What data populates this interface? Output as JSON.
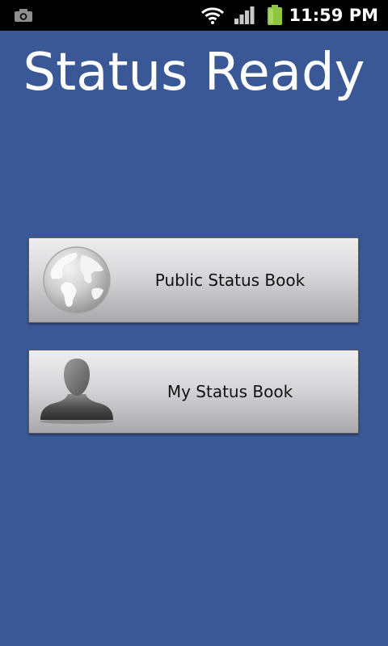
{
  "status_bar": {
    "time": "11:59 PM",
    "icons": [
      "camera-icon",
      "wifi-icon",
      "signal-icon",
      "battery-icon"
    ],
    "battery_color": "#8ec63f"
  },
  "title": "Status Ready",
  "buttons": [
    {
      "label": "Public Status Book",
      "icon": "globe-icon"
    },
    {
      "label": "My Status Book",
      "icon": "person-icon"
    }
  ],
  "colors": {
    "background": "#3a5895",
    "status_bar": "#000000"
  }
}
